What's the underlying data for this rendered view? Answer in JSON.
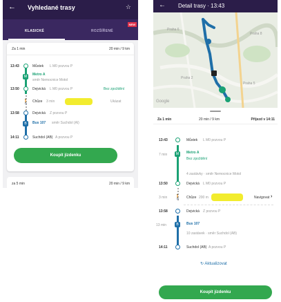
{
  "left": {
    "header": {
      "back_icon": "←",
      "title": "Vyhledané trasy",
      "star_icon": "☆"
    },
    "tabs": [
      {
        "label": "KLASICKÉ",
        "active": true
      },
      {
        "label": "ROZŠÍŘENÉ",
        "active": false
      }
    ],
    "new_badge": "NEW",
    "card": {
      "duration": "Za 1 min",
      "total": "20 min / 9 km",
      "stops": [
        {
          "time": "13:43",
          "name": "Můstek",
          "sub": "L M0 pozvou P",
          "type": "dot",
          "color": "green"
        },
        {
          "line": "Metro A",
          "sub": "směr Nemocnice Motol",
          "type": "square",
          "color": "green"
        },
        {
          "time": "13:50",
          "name": "Dejvická",
          "sub": "L M0 pozvou P",
          "extra": "Bez zpoždění",
          "type": "dot",
          "color": "green"
        },
        {
          "walk": "Chůze",
          "walk_detail": "3 min",
          "walk_right": "Ukázat",
          "type": "walk"
        },
        {
          "time": "13:58",
          "name": "Dejvická",
          "sub": "Z pozvou P",
          "type": "dot",
          "color": "blue"
        },
        {
          "line": "Bus 107",
          "sub": "směr Suchdol (Al)",
          "type": "square",
          "color": "blue"
        },
        {
          "time": "14:11",
          "name": "Suchdol (AB)",
          "sub": "A pozvou P",
          "type": "dot",
          "color": "blue"
        }
      ],
      "buy_button": "Koupit jízdenku"
    },
    "next_card": {
      "duration": "za 5 min",
      "total": "20 min / 9 km"
    }
  },
  "right": {
    "header": {
      "back_icon": "←",
      "title": "Detail trasy · 13:43"
    },
    "map": {
      "logo": "Google",
      "labels": [
        "Praha 6",
        "Praha 8",
        "Praha 2",
        "Praha 5"
      ],
      "route_color": "#1f6fa8"
    },
    "summary": {
      "duration": "Za 1 min",
      "total": "20 min / 9 km",
      "arrival": "Příjezd v 14:11"
    },
    "stops": {
      "s1_time": "13:43",
      "s1_name": "Můstek",
      "s1_sub": "L M0 pozvou P",
      "ride1_minutes": "7 min",
      "ride1_line": "Metro A",
      "ride1_delay": "Bez zpoždění",
      "ride1_stops": "4 zastávky · směr Nemocnice Motol",
      "s2_time": "13:50",
      "s2_name": "Dejvická",
      "s2_sub": "L M0 pozvou P",
      "walk_minutes": "3 min",
      "walk_label": "Chůze",
      "walk_detail": "200 m",
      "walk_nav": "Navigovat",
      "s3_time": "13:58",
      "s3_name": "Dejvická",
      "s3_sub": "Z pozvou P",
      "ride2_minutes": "13 min",
      "ride2_line": "Bus 107",
      "ride2_stops": "10 zastávek · směr Suchdol (AB)",
      "s4_time": "14:11",
      "s4_name": "Suchdol (AB)",
      "s4_sub": "A pozvou P"
    },
    "refresh_label": "Aktualizovat",
    "buy_button": "Koupit jízdenku"
  },
  "colors": {
    "header": "#2b1d49",
    "metro_green": "#1aa174",
    "bus_blue": "#1f6fa8",
    "button_green": "#33a84f",
    "highlight": "#f2ec2e"
  }
}
